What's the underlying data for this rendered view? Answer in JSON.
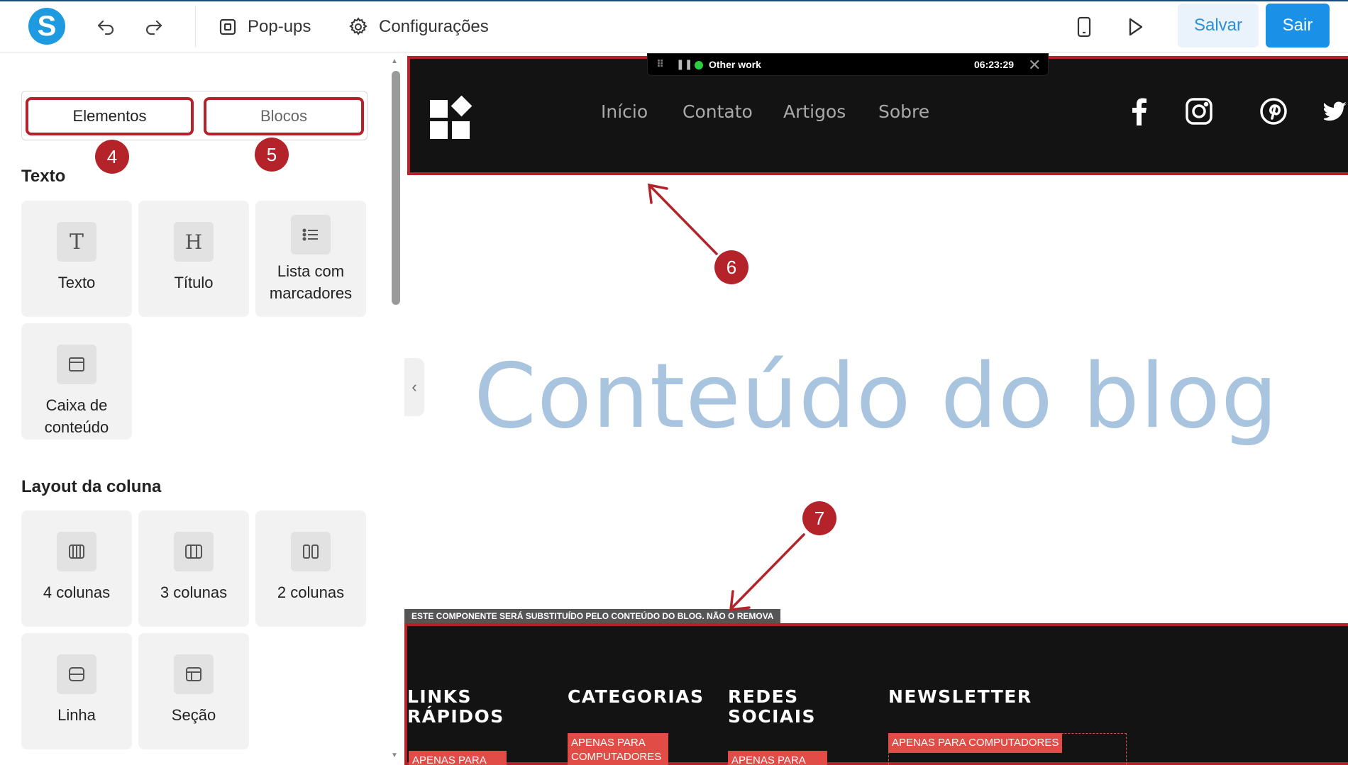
{
  "toolbar": {
    "logo_letter": "S",
    "popups_label": "Pop-ups",
    "settings_label": "Configurações",
    "save_label": "Salvar",
    "exit_label": "Sair"
  },
  "sidebar": {
    "tabs": [
      {
        "label": "Elementos"
      },
      {
        "label": "Blocos"
      }
    ],
    "section_text": {
      "title": "Texto",
      "items": [
        {
          "label": "Texto",
          "icon": "text-icon"
        },
        {
          "label": "Título",
          "icon": "heading-icon"
        },
        {
          "label": "Lista com marcadores",
          "icon": "bullet-list-icon"
        },
        {
          "label": "Caixa de conteúdo",
          "icon": "content-box-icon"
        }
      ]
    },
    "section_layout": {
      "title": "Layout da coluna",
      "items": [
        {
          "label": "4 colunas",
          "icon": "four-columns-icon"
        },
        {
          "label": "3 colunas",
          "icon": "three-columns-icon"
        },
        {
          "label": "2 colunas",
          "icon": "two-columns-icon"
        },
        {
          "label": "Linha",
          "icon": "row-icon"
        },
        {
          "label": "Seção",
          "icon": "section-icon"
        }
      ]
    }
  },
  "recording_bar": {
    "status": "Other work",
    "timer": "06:23:29"
  },
  "site_header": {
    "nav": [
      "Início",
      "Contato",
      "Artigos",
      "Sobre"
    ],
    "social_icons": [
      "facebook-icon",
      "instagram-icon",
      "pinterest-icon",
      "twitter-icon"
    ]
  },
  "hero_text": "Conteúdo do blog",
  "component_notice": "ESTE COMPONENTE SERÁ SUBSTITUÍDO PELO CONTEÚDO DO BLOG. NÃO O REMOVA",
  "footer": {
    "columns": [
      {
        "title": "LINKS RÁPIDOS",
        "tag": "APENAS PARA COMPUTADORES"
      },
      {
        "title": "CATEGORIAS",
        "tag": "APENAS PARA COMPUTADORES"
      },
      {
        "title": "REDES SOCIAIS",
        "tag": "APENAS PARA COMPUTADORES"
      },
      {
        "title": "NEWSLETTER",
        "tag": "APENAS PARA COMPUTADORES"
      }
    ]
  },
  "annotations": [
    {
      "number": "4"
    },
    {
      "number": "5"
    },
    {
      "number": "6"
    },
    {
      "number": "7"
    }
  ],
  "colors": {
    "annotation_red": "#b5232a",
    "primary_blue": "#1a91e6",
    "footer_tag": "#e24c46",
    "hero_text": "#a8c4de"
  }
}
